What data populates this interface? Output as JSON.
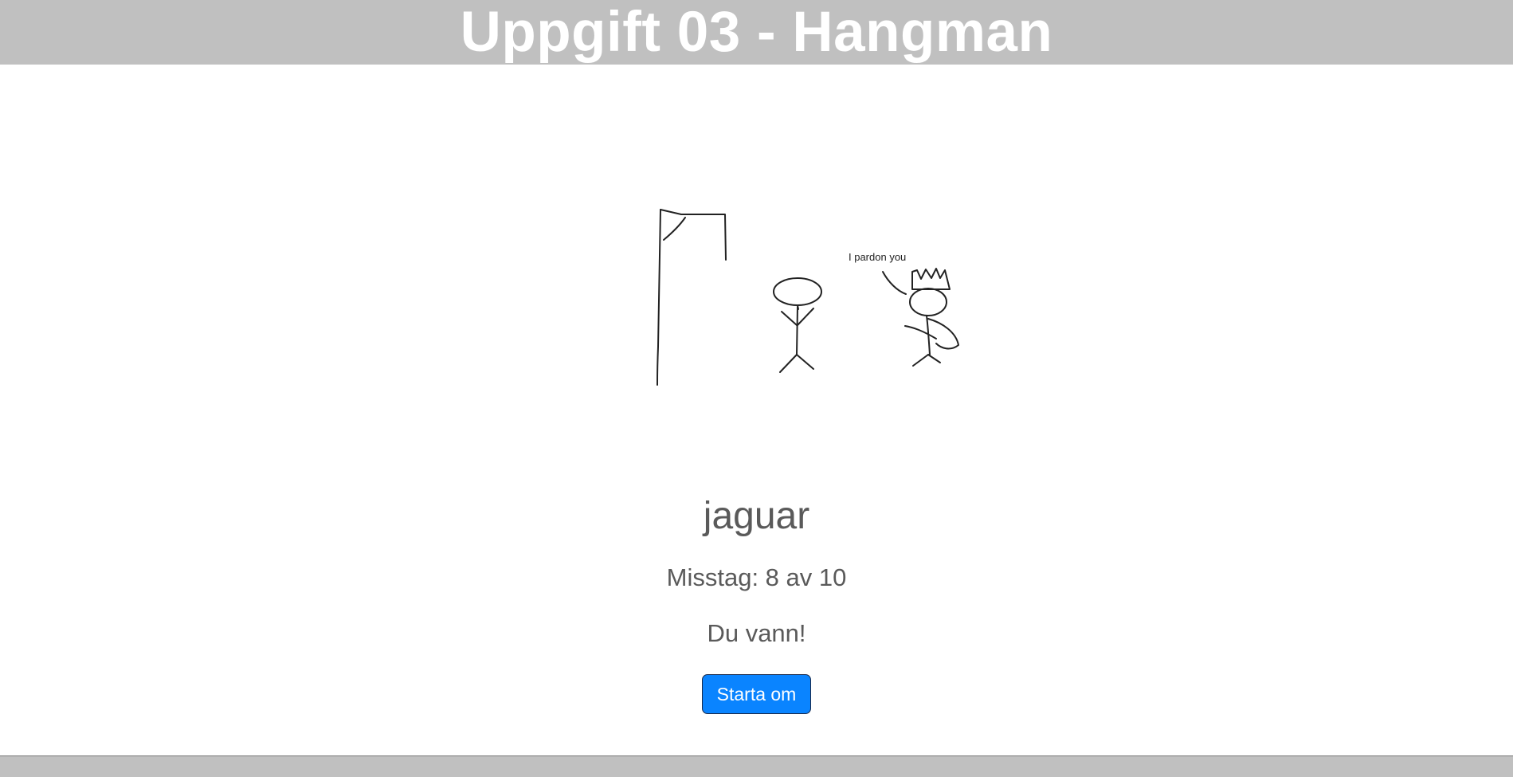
{
  "header": {
    "title": "Uppgift 03 - Hangman"
  },
  "illustration": {
    "speech_text": "I pardon you"
  },
  "game": {
    "word": "jaguar",
    "mistakes_text": "Misstag: 8 av 10",
    "mistakes": 8,
    "max_mistakes": 10,
    "result_text": "Du vann!"
  },
  "controls": {
    "restart_label": "Starta om"
  },
  "colors": {
    "header_bg": "#c0c0c0",
    "header_text": "#ffffff",
    "body_text": "#5a5a5a",
    "button_bg": "#0a84ff",
    "button_text": "#ffffff"
  }
}
